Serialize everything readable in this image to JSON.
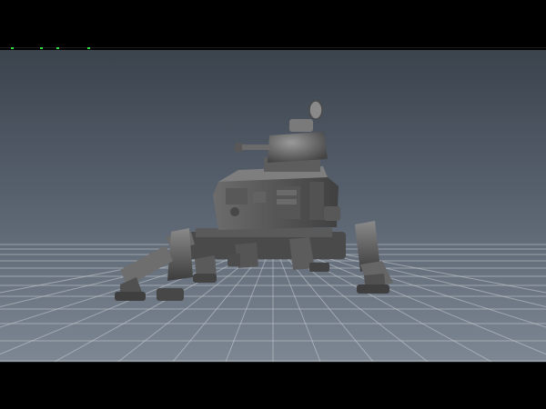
{
  "app": {
    "viewport": {
      "mode": "perspective",
      "grid": true,
      "background": {
        "top": "#3b434d",
        "bottom": "#7d8793"
      },
      "grid_color": "#c8ccd2",
      "model": {
        "name": "mech",
        "shading": "smooth gray",
        "color": "#5e5e5e"
      }
    },
    "status_markers": {
      "top_green_ticks": true,
      "bottom_green_dot": true,
      "green": "#2fe047"
    }
  }
}
